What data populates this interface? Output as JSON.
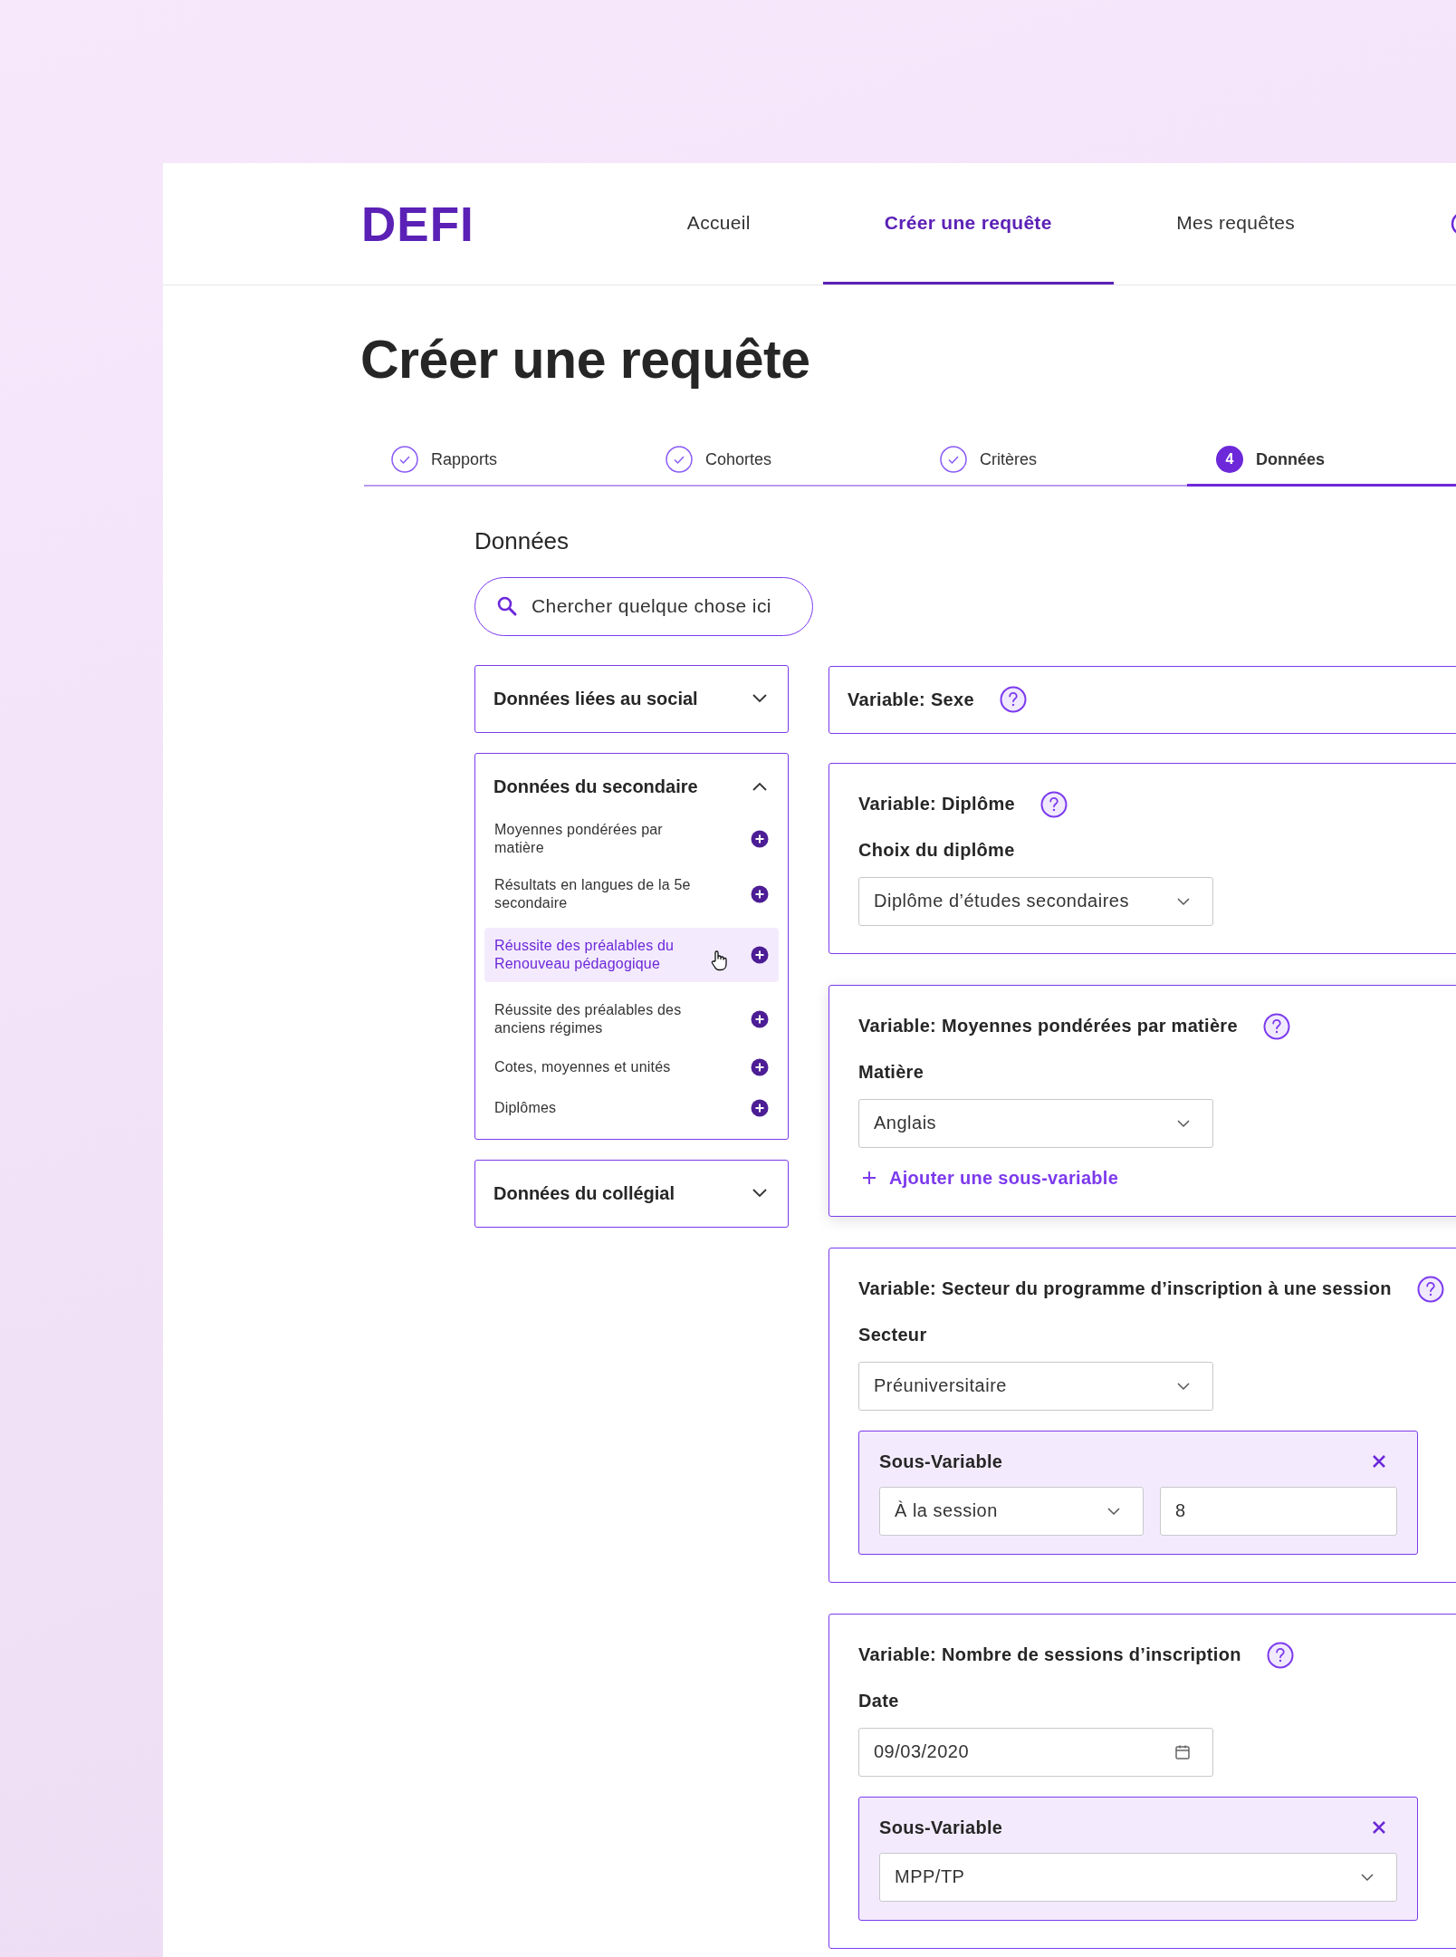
{
  "logo": "DEFI",
  "nav": [
    {
      "label": "Accueil",
      "selected": false
    },
    {
      "label": "Créer une requête",
      "selected": true
    },
    {
      "label": "Mes requêtes",
      "selected": false
    }
  ],
  "page_title": "Créer une requête",
  "steps": [
    {
      "label": "Rapports",
      "completed": true,
      "selected": false
    },
    {
      "label": "Cohortes",
      "completed": true,
      "selected": false
    },
    {
      "label": "Critères",
      "completed": true,
      "selected": false
    },
    {
      "label": "Données",
      "completed": false,
      "selected": true,
      "number": "4"
    }
  ],
  "section_title": "Données",
  "search": {
    "placeholder": "Chercher quelque chose ici"
  },
  "categories": [
    {
      "title": "Données liées au social",
      "expanded": false
    },
    {
      "title": "Données du secondaire",
      "expanded": true,
      "items": [
        {
          "label": "Moyennes pondérées par matière",
          "hovered": false
        },
        {
          "label": "Résultats en langues de la 5e secondaire",
          "hovered": false
        },
        {
          "label": "Réussite des préalables du Renouveau pédagogique",
          "hovered": true
        },
        {
          "label": "Réussite des préalables des anciens régimes",
          "hovered": false
        },
        {
          "label": "Cotes, moyennes et unités",
          "hovered": false
        },
        {
          "label": "Diplômes",
          "hovered": false
        }
      ]
    },
    {
      "title": "Données du collégial",
      "expanded": false
    }
  ],
  "variables": [
    {
      "title": "Variable: Sexe",
      "help": true,
      "focused": false
    },
    {
      "title": "Variable: Diplôme",
      "help": true,
      "focused": false,
      "field_label": "Choix du diplôme",
      "field": {
        "kind": "select",
        "value": "Diplôme d’études secondaires"
      }
    },
    {
      "title": "Variable: Moyennes pondérées par matière",
      "help": true,
      "focused": true,
      "field_label": "Matière",
      "field": {
        "kind": "select",
        "value": "Anglais"
      },
      "add_link": "Ajouter une sous-variable"
    },
    {
      "title": "Variable: Secteur du programme d’inscription à une session",
      "help": true,
      "focused": false,
      "field_label": "Secteur",
      "field": {
        "kind": "select",
        "value": "Préuniversitaire"
      },
      "sub": {
        "title": "Sous-Variable",
        "fields": [
          {
            "kind": "select",
            "value": "À la session"
          },
          {
            "kind": "text",
            "value": "8"
          }
        ]
      }
    },
    {
      "title": "Variable: Nombre de sessions d’inscription",
      "help": true,
      "focused": false,
      "field_label": "Date",
      "field": {
        "kind": "date",
        "value": "09/03/2020"
      },
      "sub": {
        "title": "Sous-Variable",
        "fields": [
          {
            "kind": "select",
            "value": "MPP/TP"
          }
        ]
      }
    }
  ]
}
